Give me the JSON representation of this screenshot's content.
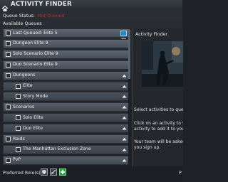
{
  "window": {
    "title": "ACTIVITY FINDER"
  },
  "queue_status": {
    "label": "Queue Status:",
    "value": "Not Queued"
  },
  "available_queues": {
    "label": "Available Queues",
    "rows": [
      {
        "label": "Last Queued: Elite 5",
        "level": 0,
        "kind": "queue",
        "info": true
      },
      {
        "label": "Dungeon Elite 9",
        "level": 0,
        "kind": "queue"
      },
      {
        "label": "Solo Scenario Elite 9",
        "level": 0,
        "kind": "queue"
      },
      {
        "label": "Duo Scenario Elite 9",
        "level": 0,
        "kind": "queue"
      },
      {
        "label": "Dungeons",
        "level": 0,
        "kind": "category",
        "expanded": true
      },
      {
        "label": "Elite",
        "level": 1,
        "kind": "queue",
        "expanded": true
      },
      {
        "label": "Story Mode",
        "level": 1,
        "kind": "queue",
        "expanded": true
      },
      {
        "label": "Scenarios",
        "level": 0,
        "kind": "category",
        "expanded": true
      },
      {
        "label": "Solo Elite",
        "level": 1,
        "kind": "queue",
        "expanded": true
      },
      {
        "label": "Duo Elite",
        "level": 1,
        "kind": "queue",
        "expanded": true
      },
      {
        "label": "Raids",
        "level": 0,
        "kind": "category",
        "expanded": true
      },
      {
        "label": "The Manhattan Exclusion Zone",
        "level": 1,
        "kind": "queue",
        "expanded": true
      },
      {
        "label": "PvP",
        "level": 0,
        "kind": "category",
        "expanded": true
      }
    ]
  },
  "detail": {
    "title": "Activity Finder",
    "line1": "Select activities to queue",
    "line2": "Click on an activity to view",
    "line3": "activity to add it to your",
    "line4": "Your team will be asked",
    "line5": "you sign up."
  },
  "footer": {
    "preferred_roles_label": "Preferred Role(s):",
    "roles": [
      {
        "name": "tank",
        "selected": false
      },
      {
        "name": "dps",
        "selected": false
      },
      {
        "name": "healer",
        "selected": true
      }
    ],
    "right_text": "P"
  },
  "colors": {
    "status_red": "#c02828",
    "info_blue": "#1f86c9",
    "healer_green": "#21a03a",
    "row_bg": "#555e69"
  }
}
